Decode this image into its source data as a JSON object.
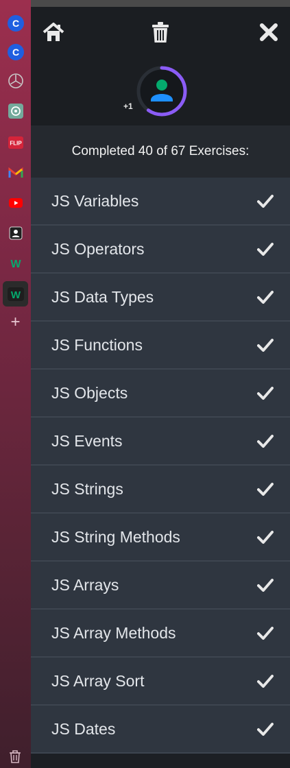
{
  "browser_sidebar": {
    "icons": [
      {
        "name": "c-app-icon-1",
        "glyph": "C",
        "color": "#1a56db"
      },
      {
        "name": "c-app-icon-2",
        "glyph": "C",
        "color": "#1a56db"
      },
      {
        "name": "mercedes-icon",
        "glyph": "⊛",
        "color": "#b4b4b4"
      },
      {
        "name": "chatgpt-icon",
        "glyph": "⚙",
        "color": "#74aa9c"
      },
      {
        "name": "flip-icon",
        "glyph": "FLIP",
        "color": "#e02424"
      },
      {
        "name": "gmail-icon",
        "glyph": "M",
        "color": "#ea4335"
      },
      {
        "name": "youtube-icon",
        "glyph": "▶",
        "color": "#ff0000"
      },
      {
        "name": "contacts-icon",
        "glyph": "▣",
        "color": "#2b2b2b"
      },
      {
        "name": "w3schools-icon-1",
        "glyph": "W",
        "color": "#04aa6d"
      },
      {
        "name": "w3schools-icon-2",
        "glyph": "W",
        "color": "#04aa6d"
      }
    ],
    "add_label": "+"
  },
  "header": {
    "avatar_extra": "+1",
    "progress_color": "#8b5cf6",
    "avatar_color": "#1e90ff",
    "avatar_head_color": "#04aa6d"
  },
  "progress": {
    "completed_text": "Completed 40 of 67 Exercises:",
    "completed": 40,
    "total": 67
  },
  "exercises": [
    {
      "label": "JS Variables",
      "done": true
    },
    {
      "label": "JS Operators",
      "done": true
    },
    {
      "label": "JS Data Types",
      "done": true
    },
    {
      "label": "JS Functions",
      "done": true
    },
    {
      "label": "JS Objects",
      "done": true
    },
    {
      "label": "JS Events",
      "done": true
    },
    {
      "label": "JS Strings",
      "done": true
    },
    {
      "label": "JS String Methods",
      "done": true
    },
    {
      "label": "JS Arrays",
      "done": true
    },
    {
      "label": "JS Array Methods",
      "done": true
    },
    {
      "label": "JS Array Sort",
      "done": true
    },
    {
      "label": "JS Dates",
      "done": true
    }
  ]
}
